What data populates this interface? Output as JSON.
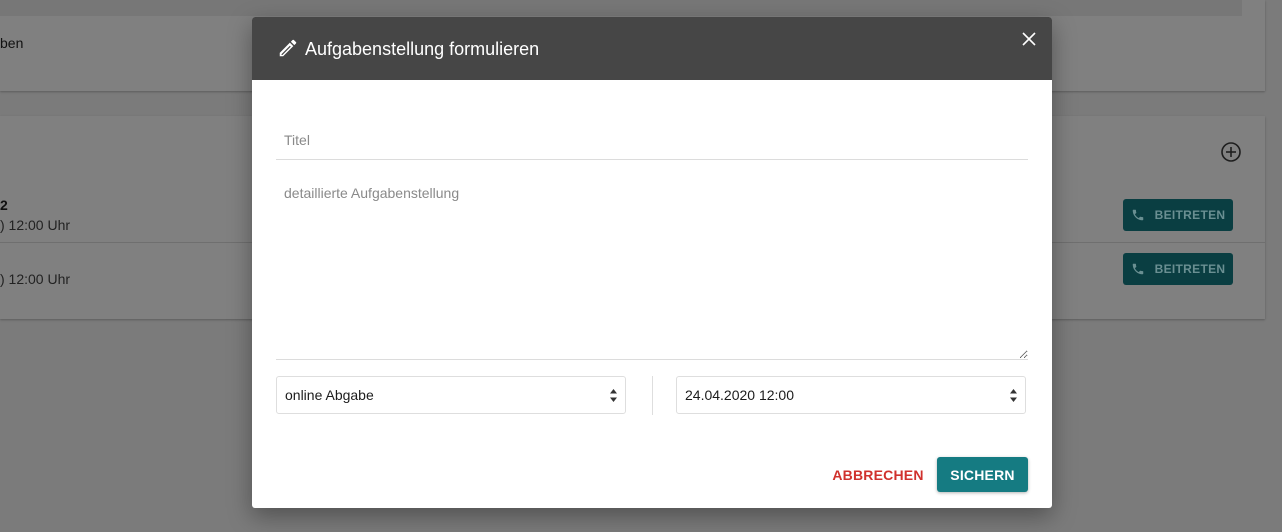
{
  "background": {
    "top_card_text": "ben",
    "session_1_title_fragment": "2",
    "session_1_time": ") 12:00 Uhr",
    "session_2_time": ") 12:00 Uhr",
    "join_button_label": "BEITRETEN",
    "icons": {
      "join": "phone-icon",
      "add": "add-circle-icon"
    }
  },
  "modal": {
    "title": "Aufgabenstellung formulieren",
    "icons": {
      "title": "pencil-icon",
      "close": "close-icon"
    },
    "title_field": {
      "placeholder": "Titel",
      "value": ""
    },
    "description_field": {
      "placeholder": "detaillierte Aufgabenstellung",
      "value": ""
    },
    "submission_type_select": {
      "selected": "online Abgabe"
    },
    "due_date_select": {
      "selected": "24.04.2020 12:00"
    },
    "cancel_label": "ABBRECHEN",
    "save_label": "SICHERN"
  },
  "colors": {
    "header_bg": "#464646",
    "accent": "#157b82",
    "danger": "#d0312d",
    "overlay": "#7b7b7b"
  }
}
